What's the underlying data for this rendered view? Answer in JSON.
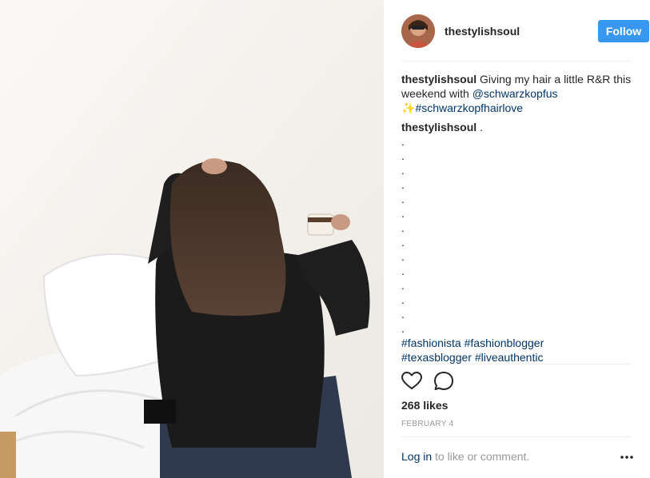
{
  "post": {
    "username": "thestylishsoul",
    "follow_label": "Follow",
    "caption_user": "thestylishsoul",
    "caption_text_1": " Giving my hair a little R&R this weekend with ",
    "caption_mention": "@schwarzkopfus",
    "caption_sparkle": "✨",
    "caption_hashtag": "#schwarzkopfhairlove",
    "comment_user": "thestylishsoul",
    "comment_text": " .",
    "comment_dots": [
      ".",
      ".",
      ".",
      ".",
      ".",
      ".",
      ".",
      ".",
      ".",
      ".",
      ".",
      ".",
      ".",
      "."
    ],
    "comment_hashtags_1": [
      "#fashionista",
      "#fashionblogger"
    ],
    "comment_hashtags_2": [
      "#texasblogger",
      "#liveauthentic"
    ],
    "likes": "268 likes",
    "date": "FEBRUARY 4",
    "login_link": "Log in",
    "login_suffix": " to like or comment."
  },
  "icons": {
    "like": "heart-icon",
    "comment": "comment-icon",
    "more": "more-options-icon"
  },
  "colors": {
    "follow_button": "#3897f0",
    "link": "#003569",
    "muted": "#999999"
  }
}
